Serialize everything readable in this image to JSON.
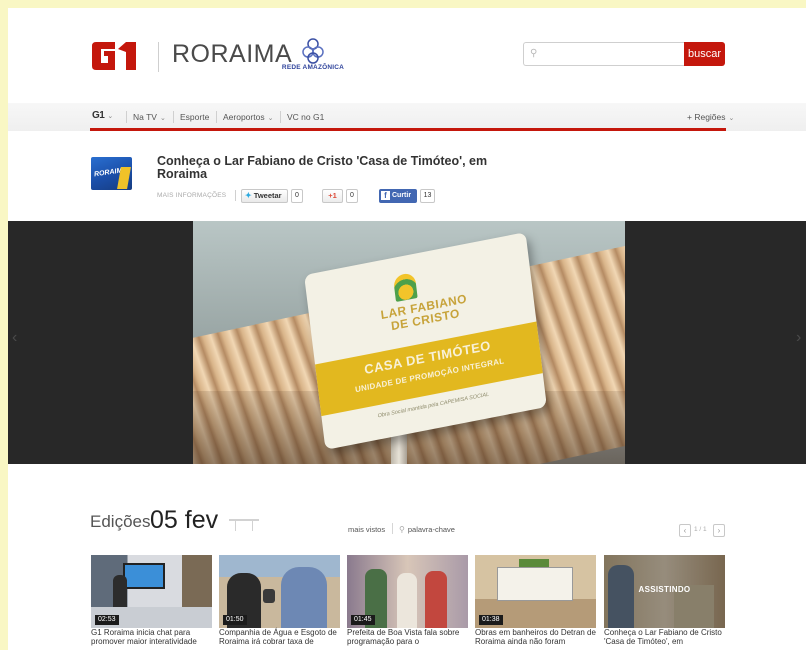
{
  "header": {
    "region": "RORAIMA",
    "network_logo": "REDE AMAZÔNICA",
    "search": {
      "placeholder": "",
      "value": "",
      "button_label": "buscar"
    }
  },
  "nav": {
    "items": [
      {
        "label": "Na TV",
        "has_dropdown": true
      },
      {
        "label": "Esporte",
        "has_dropdown": false
      },
      {
        "label": "Aeroportos",
        "has_dropdown": true
      },
      {
        "label": "VC no G1",
        "has_dropdown": false
      }
    ],
    "regions_label": "+ Regiões"
  },
  "article": {
    "program_logo_text": "RORAIMA",
    "title": "Conheça o Lar Fabiano de Cristo 'Casa de Timóteo', em Roraima",
    "more_info": "MAIS INFORMAÇÕES",
    "tweet_label": "Tweetar",
    "tweet_count": "0",
    "gplus_label": "+1",
    "gplus_count": "0",
    "like_label": "Curtir",
    "like_count": "13"
  },
  "video_sign": {
    "line1": "LAR FABIANO",
    "line2": "DE CRISTO",
    "line3": "CASA DE TIMÓTEO",
    "line4": "UNIDADE DE PROMOÇÃO INTEGRAL",
    "line5": "Obra Social mantida pela CAPEMISA SOCIAL"
  },
  "editions": {
    "label": "Edições",
    "date": "05 fev",
    "most_viewed": "mais vistos",
    "keyword": "palavra-chave",
    "pager": "1 / 1",
    "prev_icon": "chevron-left-icon",
    "next_icon": "chevron-right-icon",
    "thumbs": [
      {
        "duration": "02:53",
        "caption": "G1 Roraima inicia chat para promover maior interatividade"
      },
      {
        "duration": "01:50",
        "caption": "Companhia de Água e Esgoto de Roraima irá cobrar taxa de"
      },
      {
        "duration": "01:45",
        "caption": "Prefeita de Boa Vista fala sobre programação para o"
      },
      {
        "duration": "01:38",
        "caption": "Obras em banheiros do Detran de Roraima ainda não foram"
      },
      {
        "duration": "",
        "caption": "Conheça o Lar Fabiano de Cristo 'Casa de Timóteo', em",
        "overlay": "ASSISTINDO"
      }
    ]
  },
  "colors": {
    "brand_red": "#c4170c",
    "page_bg": "#f9f7c4",
    "player_bg": "#282828",
    "facebook_blue": "#4267b2",
    "twitter_blue": "#2aa9e0",
    "gplus_red": "#dd4b39"
  }
}
